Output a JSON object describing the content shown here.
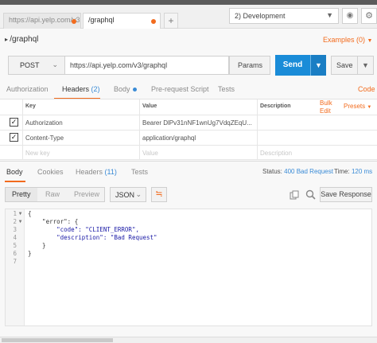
{
  "tabs": [
    {
      "label": "https://api.yelp.com/v3",
      "unsaved": true,
      "active": false
    },
    {
      "label": "/graphql",
      "unsaved": true,
      "active": true
    }
  ],
  "tab_add_label": "+",
  "environment": {
    "selected": "2) Development"
  },
  "request": {
    "name": "/graphql",
    "examples_label": "Examples (0)",
    "method": "POST",
    "url": "https://api.yelp.com/v3/graphql",
    "params_label": "Params",
    "send_label": "Send",
    "save_label": "Save"
  },
  "request_tabs": {
    "authorization": "Authorization",
    "headers": "Headers",
    "headers_count": "(2)",
    "body": "Body",
    "prerequest": "Pre-request Script",
    "tests": "Tests",
    "code": "Code"
  },
  "headers_table": {
    "col_key": "Key",
    "col_value": "Value",
    "col_description": "Description",
    "bulk_edit": "Bulk Edit",
    "presets": "Presets",
    "rows": [
      {
        "checked": true,
        "key": "Authorization",
        "value": "Bearer DlPv31nNF1wnUg7VdqZEqU..."
      },
      {
        "checked": true,
        "key": "Content-Type",
        "value": "application/graphql"
      }
    ],
    "new_key_placeholder": "New key",
    "value_placeholder": "Value",
    "description_placeholder": "Description"
  },
  "response_tabs": {
    "body": "Body",
    "cookies": "Cookies",
    "headers": "Headers",
    "headers_count": "(11)",
    "tests": "Tests"
  },
  "response_status": {
    "status_label": "Status:",
    "status_value": "400 Bad Request",
    "time_label": "Time:",
    "time_value": "120 ms"
  },
  "response_toolbar": {
    "pretty": "Pretty",
    "raw": "Raw",
    "preview": "Preview",
    "format": "JSON",
    "save_response": "Save Response"
  },
  "response_body": {
    "line_numbers": [
      "1",
      "2",
      "3",
      "4",
      "5",
      "6",
      "7"
    ],
    "lines": [
      "{",
      "    \"error\": {",
      "        \"code\": \"CLIENT_ERROR\",",
      "        \"description\": \"Bad Request\"",
      "    }",
      "}"
    ]
  },
  "icons": {
    "env_chevron": "chevron-down-icon",
    "eye": "eye-icon",
    "gear": "gear-icon",
    "wrap": "wrap-lines-icon",
    "copy": "copy-icon",
    "search": "search-icon"
  },
  "colors": {
    "accent": "#f26b1d",
    "send": "#1a8cd8",
    "link_blue": "#3a8bd6"
  }
}
